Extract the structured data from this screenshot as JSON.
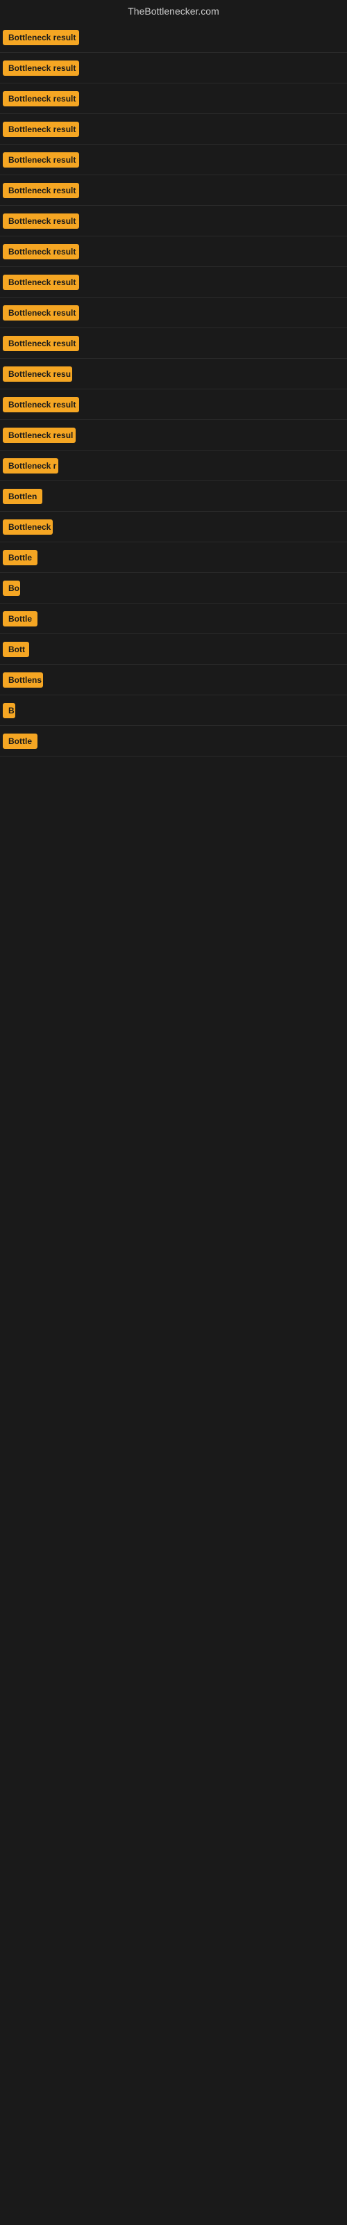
{
  "site": {
    "title": "TheBottlenecker.com"
  },
  "rows": [
    {
      "id": 1,
      "badge": "Bottleneck result",
      "badge_width": 110
    },
    {
      "id": 2,
      "badge": "Bottleneck result",
      "badge_width": 110
    },
    {
      "id": 3,
      "badge": "Bottleneck result",
      "badge_width": 110
    },
    {
      "id": 4,
      "badge": "Bottleneck result",
      "badge_width": 110
    },
    {
      "id": 5,
      "badge": "Bottleneck result",
      "badge_width": 110
    },
    {
      "id": 6,
      "badge": "Bottleneck result",
      "badge_width": 110
    },
    {
      "id": 7,
      "badge": "Bottleneck result",
      "badge_width": 110
    },
    {
      "id": 8,
      "badge": "Bottleneck result",
      "badge_width": 110
    },
    {
      "id": 9,
      "badge": "Bottleneck result",
      "badge_width": 110
    },
    {
      "id": 10,
      "badge": "Bottleneck result",
      "badge_width": 110
    },
    {
      "id": 11,
      "badge": "Bottleneck result",
      "badge_width": 110
    },
    {
      "id": 12,
      "badge": "Bottleneck resu",
      "badge_width": 100
    },
    {
      "id": 13,
      "badge": "Bottleneck result",
      "badge_width": 110
    },
    {
      "id": 14,
      "badge": "Bottleneck resul",
      "badge_width": 105
    },
    {
      "id": 15,
      "badge": "Bottleneck r",
      "badge_width": 80
    },
    {
      "id": 16,
      "badge": "Bottlen",
      "badge_width": 60
    },
    {
      "id": 17,
      "badge": "Bottleneck",
      "badge_width": 72
    },
    {
      "id": 18,
      "badge": "Bottle",
      "badge_width": 50
    },
    {
      "id": 19,
      "badge": "Bo",
      "badge_width": 25
    },
    {
      "id": 20,
      "badge": "Bottle",
      "badge_width": 50
    },
    {
      "id": 21,
      "badge": "Bott",
      "badge_width": 38
    },
    {
      "id": 22,
      "badge": "Bottlens",
      "badge_width": 58
    },
    {
      "id": 23,
      "badge": "B",
      "badge_width": 18
    },
    {
      "id": 24,
      "badge": "Bottle",
      "badge_width": 50
    }
  ]
}
